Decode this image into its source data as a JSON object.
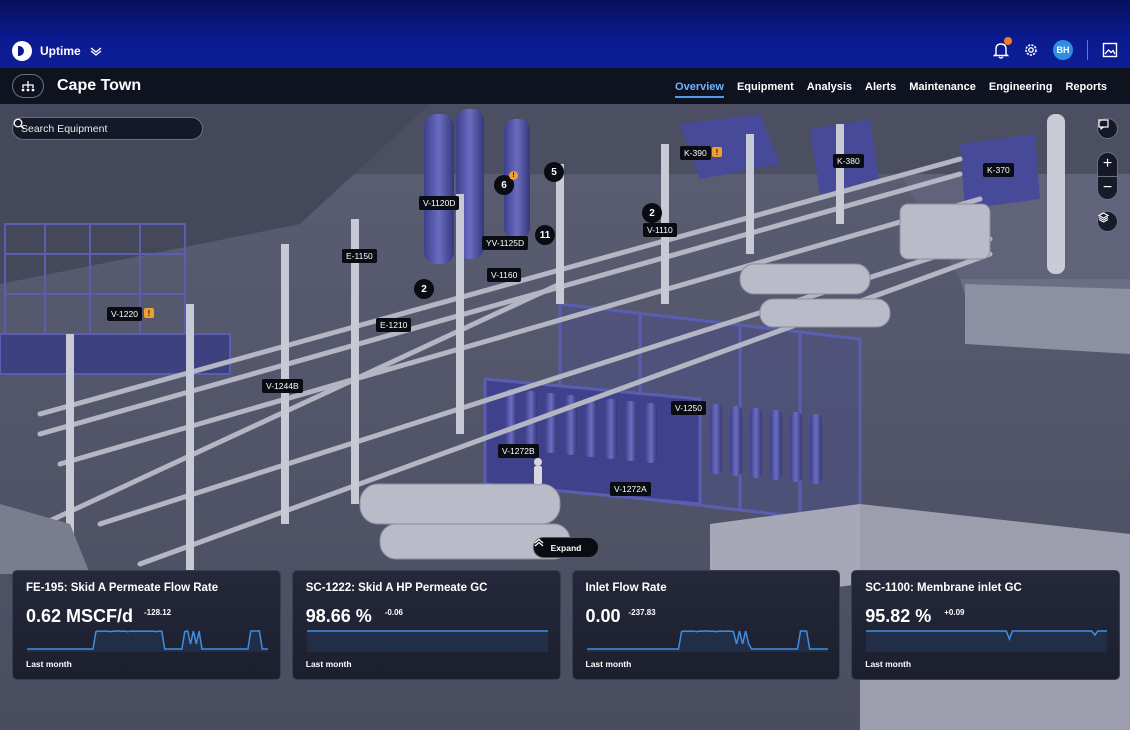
{
  "app": {
    "name": "Uptime"
  },
  "header": {
    "avatar_initials": "BH",
    "notification_dot_color": "#f07d2b"
  },
  "site": {
    "title": "Cape Town"
  },
  "tabs": [
    {
      "label": "Overview",
      "active": true
    },
    {
      "label": "Equipment"
    },
    {
      "label": "Analysis"
    },
    {
      "label": "Alerts"
    },
    {
      "label": "Maintenance"
    },
    {
      "label": "Engineering"
    },
    {
      "label": "Reports"
    }
  ],
  "search": {
    "placeholder": "Search Equipment"
  },
  "equipment_tags": [
    "K-390",
    "K-380",
    "K-370",
    "V-1120D",
    "V-1110",
    "YV-1125D",
    "E-1150",
    "V-1160",
    "V-1220",
    "E-1210",
    "V-1244B",
    "V-1250",
    "V-1272B",
    "V-1272A"
  ],
  "warning_badges": [
    "6",
    "5",
    "2",
    "11",
    "2"
  ],
  "alert_glyph": "!",
  "expand_label": "Expand",
  "cards": [
    {
      "title": "FE-195: Skid A Permeate Flow Rate",
      "value": "0.62 MSCF/d",
      "delta": "-128.12",
      "period": "Last month",
      "spark": [
        0.05,
        0.05,
        0.05,
        0.05,
        0.05,
        0.05,
        0.05,
        0.05,
        0.05,
        0.05,
        0.05,
        0.05,
        0.05,
        0.05,
        0.05,
        0.05,
        0.05,
        0.05,
        0.05,
        0.05,
        0.05,
        0.05,
        0.05,
        0.05,
        0.92,
        0.95,
        0.93,
        0.95,
        0.94,
        0.92,
        0.95,
        0.94,
        0.96,
        0.93,
        0.95,
        0.92,
        0.94,
        0.95,
        0.93,
        0.95,
        0.94,
        0.95,
        0.93,
        0.95,
        0.94,
        0.92,
        0.95,
        0.94,
        0.05,
        0.05,
        0.05,
        0.05,
        0.05,
        0.05,
        0.05,
        0.92,
        0.95,
        0.3,
        0.95,
        0.3,
        0.95,
        0.05,
        0.05,
        0.05,
        0.05,
        0.05,
        0.05,
        0.05,
        0.05,
        0.05,
        0.05,
        0.05,
        0.05,
        0.05,
        0.05,
        0.05,
        0.05,
        0.05,
        0.95,
        0.95,
        0.95,
        0.95,
        0.05,
        0.05,
        0.05
      ]
    },
    {
      "title": "SC-1222: Skid A HP Permeate GC",
      "value": "98.66 %",
      "delta": "-0.06",
      "period": "Last month",
      "spark": [
        0.95,
        0.95,
        0.95,
        0.95,
        0.95,
        0.95,
        0.95,
        0.95,
        0.95,
        0.95,
        0.95,
        0.95,
        0.95,
        0.95,
        0.95,
        0.95,
        0.95,
        0.95,
        0.95,
        0.95,
        0.95,
        0.95,
        0.95,
        0.95,
        0.95,
        0.95,
        0.95,
        0.95,
        0.95,
        0.95,
        0.95,
        0.95,
        0.95,
        0.95,
        0.95,
        0.95,
        0.95,
        0.95,
        0.95,
        0.95
      ]
    },
    {
      "title": "Inlet Flow Rate",
      "value": "0.00",
      "delta": "-237.83",
      "period": "Last month",
      "spark": [
        0.05,
        0.05,
        0.05,
        0.05,
        0.05,
        0.05,
        0.05,
        0.05,
        0.05,
        0.05,
        0.05,
        0.05,
        0.05,
        0.05,
        0.05,
        0.05,
        0.05,
        0.05,
        0.05,
        0.05,
        0.05,
        0.05,
        0.05,
        0.05,
        0.05,
        0.05,
        0.05,
        0.05,
        0.05,
        0.05,
        0.05,
        0.92,
        0.95,
        0.93,
        0.95,
        0.94,
        0.92,
        0.95,
        0.94,
        0.96,
        0.93,
        0.95,
        0.92,
        0.94,
        0.95,
        0.93,
        0.95,
        0.94,
        0.92,
        0.3,
        0.95,
        0.3,
        0.95,
        0.3,
        0.05,
        0.05,
        0.05,
        0.05,
        0.05,
        0.05,
        0.05,
        0.05,
        0.05,
        0.05,
        0.05,
        0.05,
        0.05,
        0.05,
        0.05,
        0.05,
        0.95,
        0.95,
        0.95,
        0.05,
        0.05,
        0.05,
        0.05,
        0.05,
        0.05,
        0.05
      ]
    },
    {
      "title": "SC-1100: Membrane inlet GC",
      "value": "95.82 %",
      "delta": "+0.09",
      "period": "Last month",
      "spark": [
        0.95,
        0.95,
        0.95,
        0.95,
        0.95,
        0.95,
        0.95,
        0.95,
        0.95,
        0.95,
        0.95,
        0.95,
        0.95,
        0.95,
        0.95,
        0.95,
        0.95,
        0.95,
        0.95,
        0.95,
        0.95,
        0.95,
        0.95,
        0.95,
        0.95,
        0.95,
        0.95,
        0.95,
        0.95,
        0.95,
        0.95,
        0.95,
        0.95,
        0.95,
        0.95,
        0.95,
        0.95,
        0.95,
        0.95,
        0.95,
        0.95,
        0.95,
        0.95,
        0.95,
        0.95,
        0.95,
        0.95,
        0.55,
        0.95,
        0.95,
        0.95,
        0.95,
        0.95,
        0.95,
        0.95,
        0.95,
        0.95,
        0.95,
        0.95,
        0.95,
        0.95,
        0.95,
        0.95,
        0.95,
        0.95,
        0.95,
        0.95,
        0.95,
        0.95,
        0.95,
        0.95,
        0.95,
        0.95,
        0.95,
        0.95,
        0.75,
        0.95,
        0.95,
        0.95,
        0.95
      ]
    }
  ],
  "colors": {
    "accent": "#4f9bf0",
    "spark": "#3c8fe6",
    "warning": "#f0a030",
    "equipment_blue": "#5558a8"
  }
}
